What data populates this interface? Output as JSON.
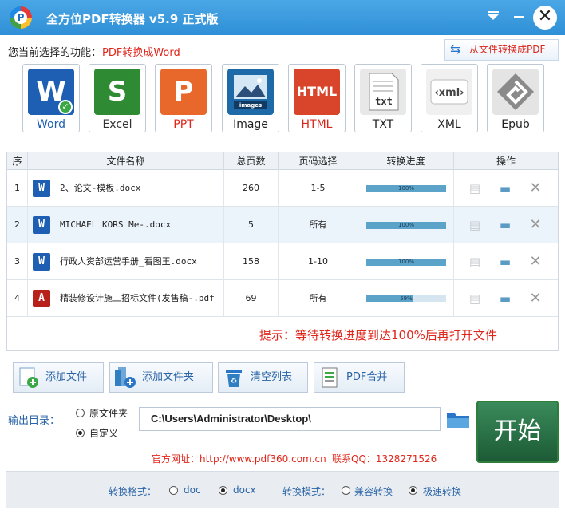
{
  "window": {
    "title": "全方位PDF转换器 v5.9 正式版",
    "logo_letter": "P",
    "menu_icon": "dropdown-arrow-icon",
    "min_icon": "minimize-icon",
    "close_icon": "close-icon"
  },
  "function_bar": {
    "label": "您当前选择的功能：",
    "value": "PDF转换成Word",
    "from_file_button": "从文件转换成PDF"
  },
  "formats": [
    {
      "label": "Word",
      "glyph": "W",
      "color": "#1e5fb3",
      "selected": true
    },
    {
      "label": "Excel",
      "glyph": "S",
      "color": "#2e8b33"
    },
    {
      "label": "PPT",
      "glyph": "P",
      "color": "#e8672a"
    },
    {
      "label": "Image",
      "glyph": "images",
      "color": "#1e6aa8"
    },
    {
      "label": "HTML",
      "glyph": "HTML",
      "color": "#d9452b"
    },
    {
      "label": "TXT",
      "glyph": "txt",
      "color": "#e8e8e8"
    },
    {
      "label": "XML",
      "glyph": "‹xml›",
      "color": "#f0f0f0"
    },
    {
      "label": "Epub",
      "glyph": "e",
      "color": "#8a8a8a"
    }
  ],
  "table": {
    "headers": [
      "序",
      "文件名称",
      "总页数",
      "页码选择",
      "转换进度",
      "操作"
    ],
    "rows": [
      {
        "no": "1",
        "name": "2、论文-模板.docx",
        "pages": "260",
        "range": "1-5",
        "progress": 100,
        "progress_text": "100%",
        "type": "word"
      },
      {
        "no": "2",
        "name": "MICHAEL KORS Me-.docx",
        "pages": "5",
        "range": "所有",
        "progress": 100,
        "progress_text": "100%",
        "type": "word"
      },
      {
        "no": "3",
        "name": "行政人资部运营手册_看图王.docx",
        "pages": "158",
        "range": "1-10",
        "progress": 100,
        "progress_text": "100%",
        "type": "word"
      },
      {
        "no": "4",
        "name": "精装修设计施工招标文件(发售稿-.pdf",
        "pages": "69",
        "range": "所有",
        "progress": 59,
        "progress_text": "59%",
        "type": "pdf"
      }
    ],
    "hint": "提示：等待转换进度到达100%后再打开文件"
  },
  "actions": {
    "add_file": "添加文件",
    "add_folder": "添加文件夹",
    "clear_list": "清空列表",
    "pdf_merge": "PDF合并"
  },
  "output": {
    "label": "输出目录：",
    "option_original": "原文件夹",
    "option_custom": "自定义",
    "selected": "custom",
    "path": "C:\\Users\\Administrator\\Desktop\\",
    "start": "开始"
  },
  "info": {
    "site": "官方网址：http://www.pdf360.com.cn",
    "qq": "联系QQ：1328271526"
  },
  "footer": {
    "format_label": "转换格式：",
    "format_doc": "doc",
    "format_docx": "docx",
    "format_selected": "docx",
    "mode_label": "转换模式：",
    "mode_compat": "兼容转换",
    "mode_fast": "极速转换",
    "mode_selected": "fast"
  }
}
